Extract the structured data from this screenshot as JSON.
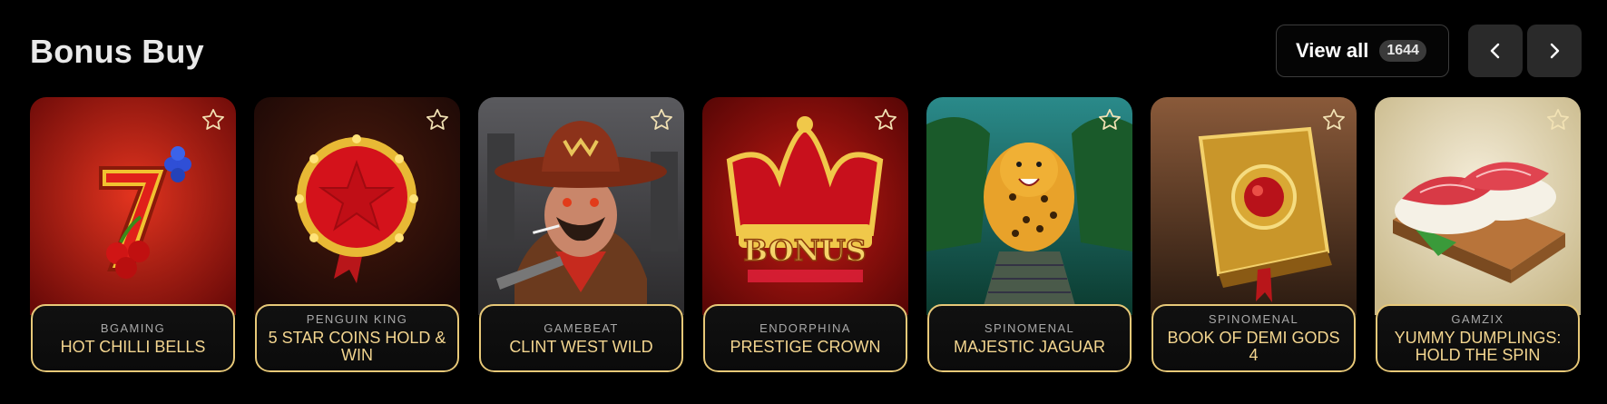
{
  "section": {
    "title": "Bonus Buy",
    "view_all_label": "View all",
    "view_all_count": "1644"
  },
  "colors": {
    "background": "#000000",
    "card_border_gold": "#e7c878",
    "game_title_gold": "#f3d58f",
    "provider_gray": "#a9a9a9",
    "nav_button": "#2a2a2a"
  },
  "icons": {
    "prev": "chevron-left-icon",
    "next": "chevron-right-icon",
    "favorite": "star-outline-icon"
  },
  "games": [
    {
      "provider": "BGAMING",
      "name": "HOT CHILLI BELLS",
      "art": "lucky-seven-cherries"
    },
    {
      "provider": "PENGUIN KING",
      "name": "5 STAR COINS HOLD & WIN",
      "art": "red-star-coin"
    },
    {
      "provider": "GAMEBEAT",
      "name": "CLINT WEST WILD",
      "art": "cowboy"
    },
    {
      "provider": "ENDORPHINA",
      "name": "PRESTIGE CROWN",
      "art": "crown-bonus"
    },
    {
      "provider": "SPINOMENAL",
      "name": "MAJESTIC JAGUAR",
      "art": "jaguar"
    },
    {
      "provider": "SPINOMENAL",
      "name": "BOOK OF DEMI GODS 4",
      "art": "golden-book"
    },
    {
      "provider": "GAMZIX",
      "name": "YUMMY DUMPLINGS: HOLD THE SPIN",
      "art": "sushi"
    }
  ]
}
